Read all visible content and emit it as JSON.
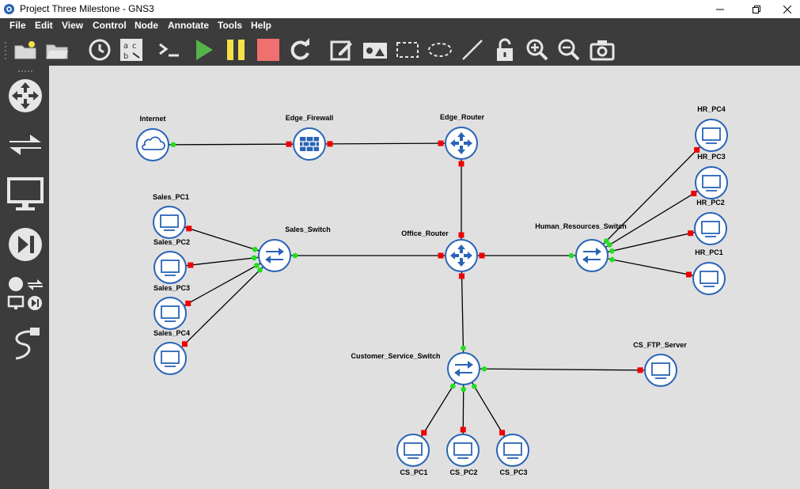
{
  "window": {
    "title": "Project Three Milestone - GNS3",
    "controls": {
      "minimize": "—",
      "restore": "❐",
      "close": "✕"
    }
  },
  "menu": [
    {
      "label": "File",
      "icon": null
    },
    {
      "label": "Edit",
      "icon": null
    },
    {
      "label": "View",
      "icon": null
    },
    {
      "label": "Control",
      "icon": null
    },
    {
      "label": "Node",
      "icon": null
    },
    {
      "label": "Annotate",
      "icon": null
    },
    {
      "label": "Tools",
      "icon": null
    },
    {
      "label": "Help",
      "icon": null
    }
  ],
  "toolbar": [
    {
      "name": "new-project-folder-icon"
    },
    {
      "name": "open-folder-icon"
    },
    {
      "name": "snapshot-clock-icon"
    },
    {
      "name": "show-interface-labels-icon"
    },
    {
      "name": "console-icon",
      "text": ">_"
    },
    {
      "name": "start-play-icon",
      "color": "#55b34a"
    },
    {
      "name": "pause-icon",
      "color": "#f5e04a"
    },
    {
      "name": "stop-icon",
      "color": "#f07070"
    },
    {
      "name": "reload-icon"
    },
    {
      "name": "add-note-icon"
    },
    {
      "name": "insert-picture-icon"
    },
    {
      "name": "draw-rectangle-icon"
    },
    {
      "name": "draw-ellipse-icon"
    },
    {
      "name": "draw-line-icon"
    },
    {
      "name": "lock-icon"
    },
    {
      "name": "zoom-in-icon"
    },
    {
      "name": "zoom-out-icon"
    },
    {
      "name": "screenshot-camera-icon"
    }
  ],
  "dock": [
    {
      "name": "routers-category-icon"
    },
    {
      "name": "switches-category-icon"
    },
    {
      "name": "end-devices-category-icon"
    },
    {
      "name": "security-devices-category-icon"
    },
    {
      "name": "all-devices-category-icon"
    },
    {
      "name": "add-link-icon"
    }
  ],
  "colors": {
    "node_fill": "#ffffff",
    "node_stroke": "#2a64b6",
    "port_up": "#22dd22",
    "port_down": "#ee0000",
    "canvas_bg": "#e0e0e0",
    "chrome_bg": "#3c3c3c"
  },
  "topology": {
    "nodes": {
      "internet": {
        "label": "Internet",
        "type": "cloud"
      },
      "edge_firewall": {
        "label": "Edge_Firewall",
        "type": "firewall"
      },
      "edge_router": {
        "label": "Edge_Router",
        "type": "router"
      },
      "office_router": {
        "label": "Office_Router",
        "type": "router"
      },
      "sales_switch": {
        "label": "Sales_Switch",
        "type": "switch"
      },
      "hr_switch": {
        "label": "Human_Resources_Switch",
        "type": "switch"
      },
      "cs_switch": {
        "label": "Customer_Service_Switch",
        "type": "switch"
      },
      "sales_pc1": {
        "label": "Sales_PC1",
        "type": "pc"
      },
      "sales_pc2": {
        "label": "Sales_PC2",
        "type": "pc"
      },
      "sales_pc3": {
        "label": "Sales_PC3",
        "type": "pc"
      },
      "sales_pc4": {
        "label": "Sales_PC4",
        "type": "pc"
      },
      "hr_pc4": {
        "label": "HR_PC4",
        "type": "pc"
      },
      "hr_pc3": {
        "label": "HR_PC3",
        "type": "pc"
      },
      "hr_pc2": {
        "label": "HR_PC2",
        "type": "pc"
      },
      "hr_pc1": {
        "label": "HR_PC1",
        "type": "pc"
      },
      "cs_ftp_server": {
        "label": "CS_FTP_Server",
        "type": "pc"
      },
      "cs_pc1": {
        "label": "CS_PC1",
        "type": "pc"
      },
      "cs_pc2": {
        "label": "CS_PC2",
        "type": "pc"
      },
      "cs_pc3": {
        "label": "CS_PC3",
        "type": "pc"
      }
    },
    "links": [
      {
        "a": "internet",
        "b": "edge_firewall",
        "a_status": "up",
        "b_status": "down"
      },
      {
        "a": "edge_firewall",
        "b": "edge_router",
        "a_status": "down",
        "b_status": "down"
      },
      {
        "a": "edge_router",
        "b": "office_router",
        "a_status": "down",
        "b_status": "down"
      },
      {
        "a": "office_router",
        "b": "sales_switch",
        "a_status": "down",
        "b_status": "up"
      },
      {
        "a": "office_router",
        "b": "hr_switch",
        "a_status": "down",
        "b_status": "up"
      },
      {
        "a": "office_router",
        "b": "cs_switch",
        "a_status": "down",
        "b_status": "up"
      },
      {
        "a": "sales_switch",
        "b": "sales_pc1",
        "a_status": "up",
        "b_status": "down"
      },
      {
        "a": "sales_switch",
        "b": "sales_pc2",
        "a_status": "up",
        "b_status": "down"
      },
      {
        "a": "sales_switch",
        "b": "sales_pc3",
        "a_status": "up",
        "b_status": "down"
      },
      {
        "a": "sales_switch",
        "b": "sales_pc4",
        "a_status": "up",
        "b_status": "down"
      },
      {
        "a": "hr_switch",
        "b": "hr_pc4",
        "a_status": "up",
        "b_status": "down"
      },
      {
        "a": "hr_switch",
        "b": "hr_pc3",
        "a_status": "up",
        "b_status": "down"
      },
      {
        "a": "hr_switch",
        "b": "hr_pc2",
        "a_status": "up",
        "b_status": "down"
      },
      {
        "a": "hr_switch",
        "b": "hr_pc1",
        "a_status": "up",
        "b_status": "down"
      },
      {
        "a": "cs_switch",
        "b": "cs_ftp_server",
        "a_status": "up",
        "b_status": "down"
      },
      {
        "a": "cs_switch",
        "b": "cs_pc1",
        "a_status": "up",
        "b_status": "down"
      },
      {
        "a": "cs_switch",
        "b": "cs_pc2",
        "a_status": "up",
        "b_status": "down"
      },
      {
        "a": "cs_switch",
        "b": "cs_pc3",
        "a_status": "up",
        "b_status": "down"
      }
    ]
  }
}
